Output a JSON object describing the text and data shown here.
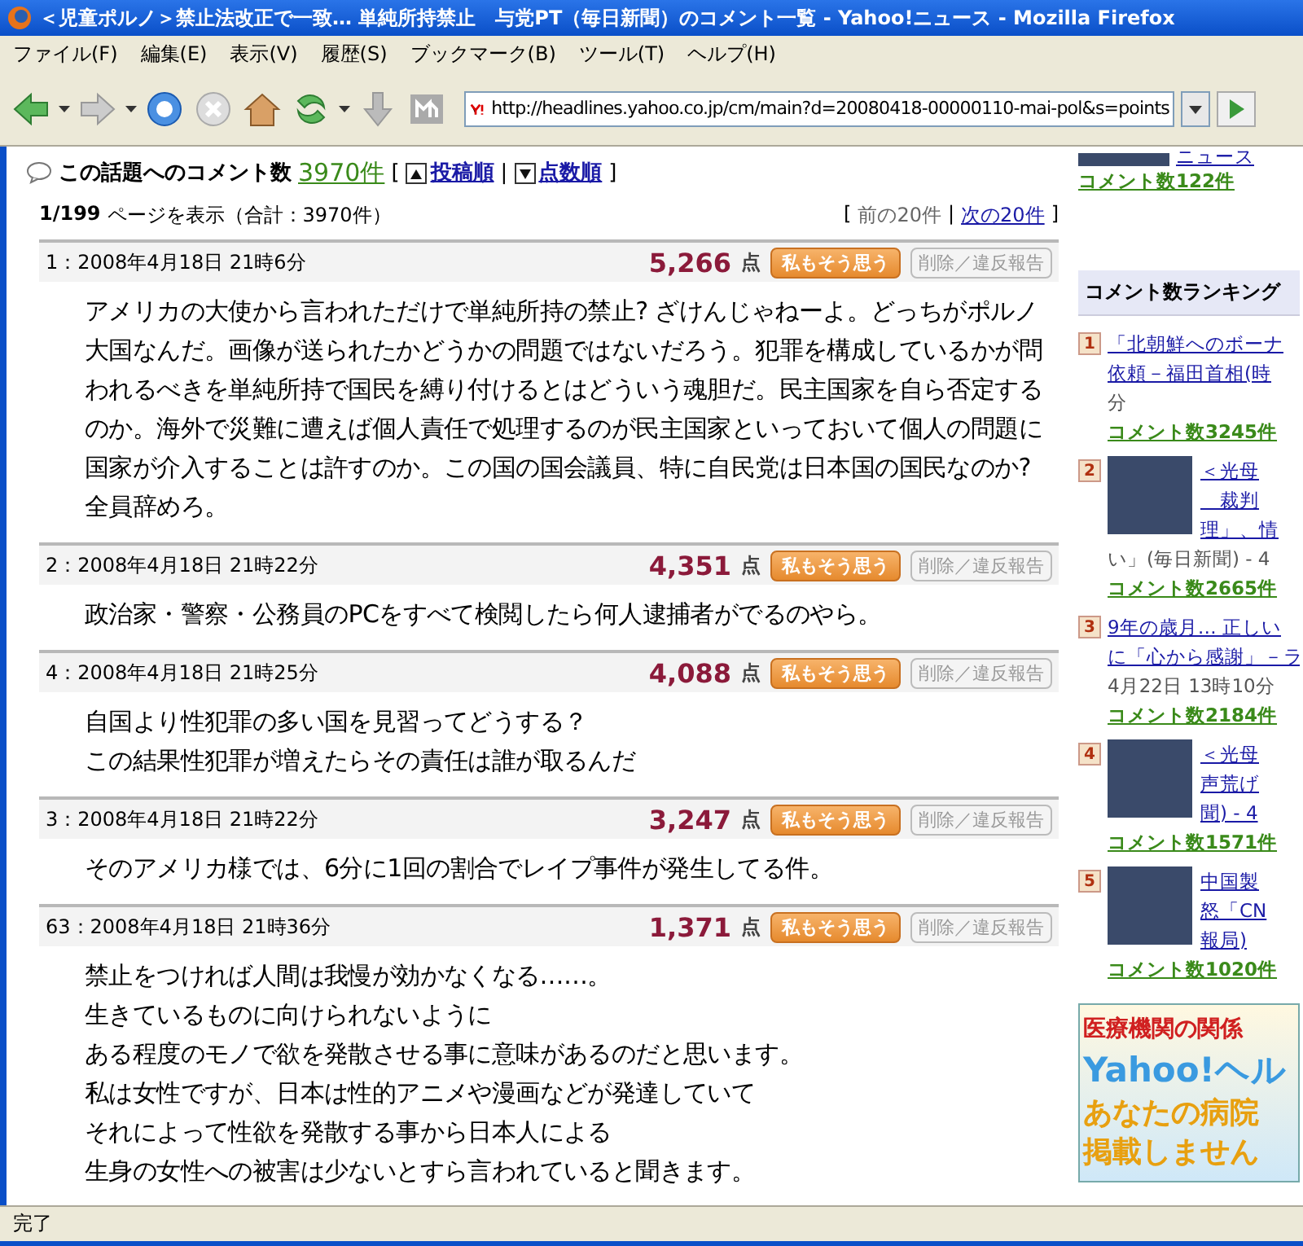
{
  "window": {
    "title": "＜児童ポルノ＞禁止法改正で一致… 単純所持禁止　与党PT（毎日新聞）のコメント一覧 - Yahoo!ニュース - Mozilla Firefox"
  },
  "menu": [
    "ファイル(F)",
    "編集(E)",
    "表示(V)",
    "履歴(S)",
    "ブックマーク(B)",
    "ツール(T)",
    "ヘルプ(H)"
  ],
  "toolbar": {
    "url": "http://headlines.yahoo.co.jp/cm/main?d=20080418-00000110-mai-pol&s=points"
  },
  "summary": {
    "label": "この話題へのコメント数",
    "count": "3970件",
    "open": "[",
    "separator": "|",
    "close": "]",
    "sorts": [
      {
        "label": "投稿順",
        "kind": "up"
      },
      {
        "label": "点数順",
        "kind": "down"
      }
    ]
  },
  "page_nav": {
    "page": "1/199",
    "text": "ページを表示（合計：3970件）",
    "open": "[",
    "separator": "|",
    "close": "]",
    "links": [
      {
        "label": "前の20件",
        "disabled": true
      },
      {
        "label": "次の20件",
        "disabled": false
      }
    ]
  },
  "comments": [
    {
      "header": "1：2008年4月18日 21時6分",
      "points": "5,266",
      "unit": "点",
      "agree": "私もそう思う",
      "report": "削除／違反報告",
      "body": "アメリカの大使から言われただけで単純所持の禁止? ざけんじゃねーよ。どっちがポルノ大国なんだ。画像が送られたかどうかの問題ではないだろう。犯罪を構成しているかが問われるべきを単純所持で国民を縛り付けるとはどういう魂胆だ。民主国家を自ら否定するのか。海外で災難に遭えば個人責任で処理するのが民主国家といっておいて個人の問題に国家が介入することは許すのか。この国の国会議員、特に自民党は日本国の国民なのか? 全員辞めろ。"
    },
    {
      "header": "2：2008年4月18日 21時22分",
      "points": "4,351",
      "unit": "点",
      "agree": "私もそう思う",
      "report": "削除／違反報告",
      "body": "政治家・警察・公務員のPCをすべて検閲したら何人逮捕者がでるのやら。"
    },
    {
      "header": "4：2008年4月18日 21時25分",
      "points": "4,088",
      "unit": "点",
      "agree": "私もそう思う",
      "report": "削除／違反報告",
      "body": "自国より性犯罪の多い国を見習ってどうする？",
      "more_lines": [
        "この結果性犯罪が増えたらその責任は誰が取るんだ"
      ]
    },
    {
      "header": "3：2008年4月18日 21時22分",
      "points": "3,247",
      "unit": "点",
      "agree": "私もそう思う",
      "report": "削除／違反報告",
      "body": "そのアメリカ様では、6分に1回の割合でレイプ事件が発生してる件。"
    },
    {
      "header": "63：2008年4月18日 21時36分",
      "points": "1,371",
      "unit": "点",
      "agree": "私もそう思う",
      "report": "削除／違反報告",
      "body": "禁止をつければ人間は我慢が効かなくなる……。",
      "more_lines": [
        "生きているものに向けられないように",
        "ある程度のモノで欲を発散させる事に意味があるのだと思います。",
        "私は女性ですが、日本は性的アニメや漫画などが発達していて",
        "それによって性欲を発散する事から日本人による",
        "生身の女性への被害は少ないとすら言われていると聞きます。"
      ]
    }
  ],
  "sidebar": {
    "top": {
      "lines": [
        "ニュース"
      ],
      "count": "コメント数122件"
    },
    "ranking_title": "コメント数ランキング",
    "ranking": [
      {
        "rank": "1",
        "kind": "text",
        "lines": [
          "「北朝鮮へのボーナ",
          "依頼－福田首相(時"
        ],
        "after": [
          "分"
        ],
        "count": "コメント数3245件"
      },
      {
        "rank": "2",
        "kind": "photo",
        "lines": [
          "＜光母",
          "　裁判",
          "理」、情"
        ],
        "after": [
          "い」(毎日新聞) - 4"
        ],
        "count": "コメント数2665件"
      },
      {
        "rank": "3",
        "kind": "text",
        "lines": [
          "9年の歳月… 正しい",
          "に「心から感謝」－ラ"
        ],
        "after": [
          "4月22日 13時10分"
        ],
        "count": "コメント数2184件"
      },
      {
        "rank": "4",
        "kind": "photo",
        "lines": [
          "＜光母",
          "声荒げ",
          "聞) - 4"
        ],
        "count": "コメント数1571件"
      },
      {
        "rank": "5",
        "kind": "photo",
        "lines": [
          "中国製",
          "怒「CN",
          "報局)"
        ],
        "count": "コメント数1020件"
      }
    ],
    "ad": [
      "医療機関の関係",
      "Yahoo!ヘル",
      "あなたの病院",
      "掲載しません"
    ]
  },
  "status_bar": "完了"
}
